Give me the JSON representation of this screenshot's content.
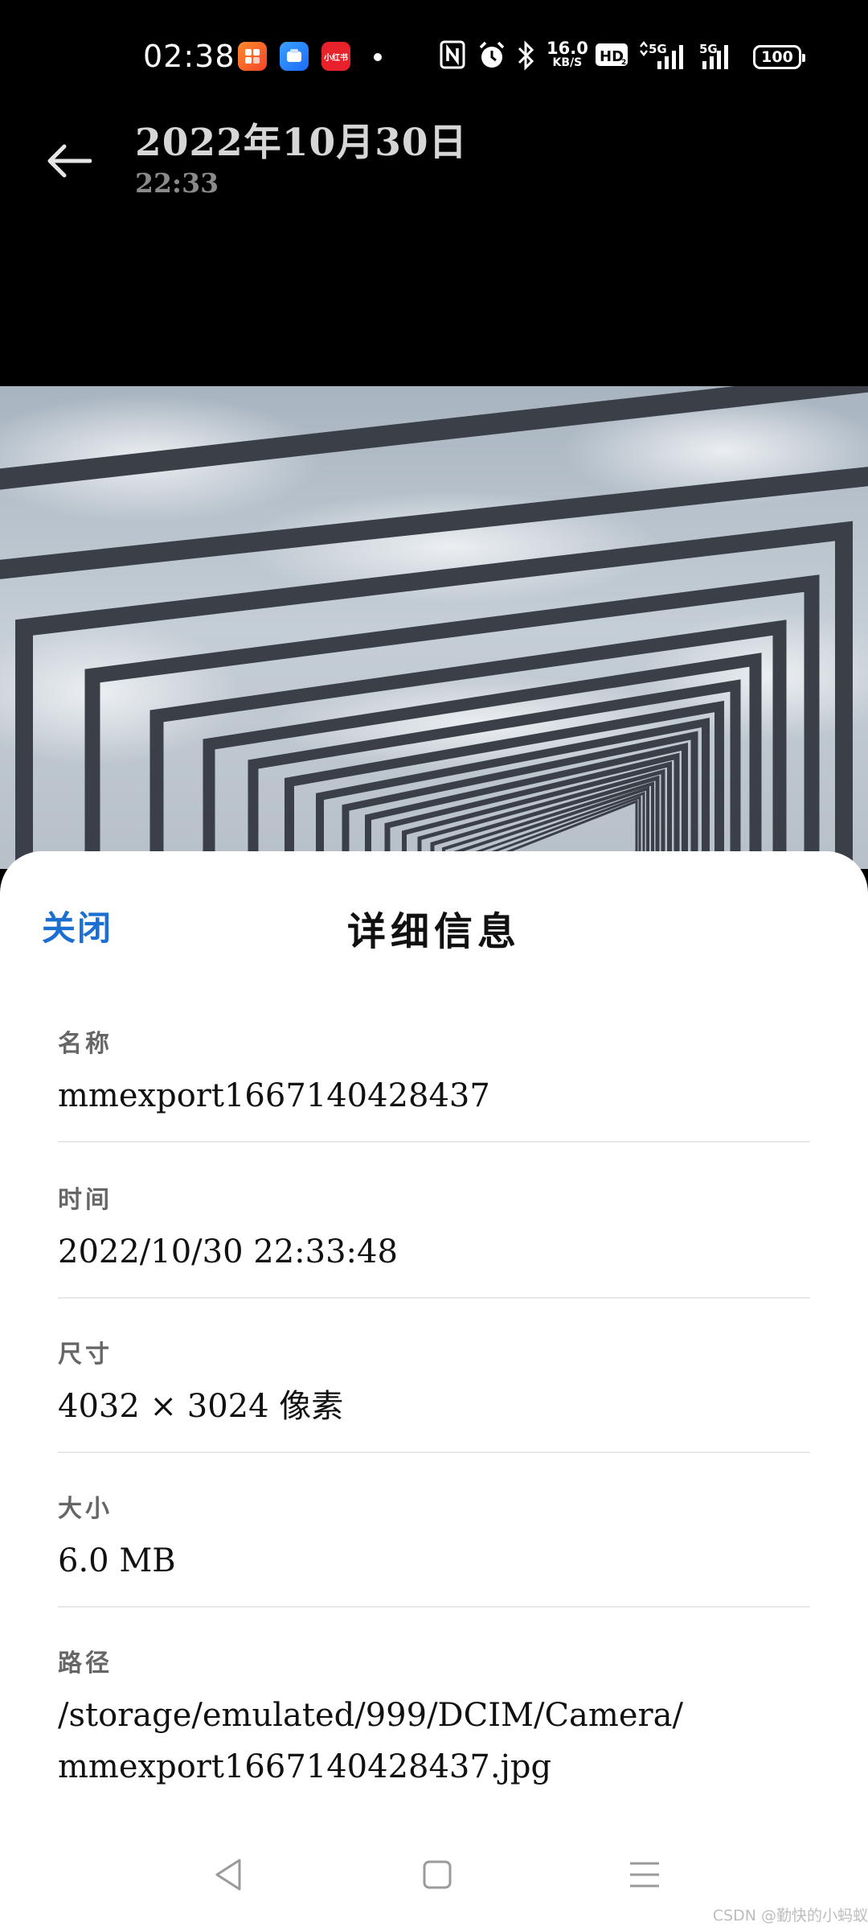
{
  "status_bar": {
    "time": "02:38",
    "apps": [
      {
        "icon": "app-orange-icon",
        "label": ""
      },
      {
        "icon": "app-blue-icon",
        "label": ""
      },
      {
        "icon": "app-red-icon",
        "label": "小红书"
      }
    ],
    "icons": [
      "nfc-icon",
      "alarm-icon",
      "bluetooth-icon",
      "hd-icon",
      "signal-5g-icon",
      "signal-5g-icon"
    ],
    "speed_value": "16.0",
    "speed_unit": "KB/S",
    "battery": "100"
  },
  "header": {
    "date": "2022年10月30日",
    "time": "22:33"
  },
  "sheet": {
    "close_label": "关闭",
    "title": "详细信息",
    "rows": [
      {
        "label": "名称",
        "value": "mmexport1667140428437"
      },
      {
        "label": "时间",
        "value": "2022/10/30 22:33:48"
      },
      {
        "label": "尺寸",
        "value": "4032 × 3024 像素"
      },
      {
        "label": "大小",
        "value": "6.0 MB"
      },
      {
        "label": "路径",
        "value_line1": "/storage/emulated/999/DCIM/Camera/",
        "value_line2": "mmexport1667140428437.jpg"
      }
    ]
  },
  "nav": [
    "back-nav-icon",
    "home-nav-icon",
    "menu-nav-icon"
  ],
  "watermark": "CSDN @勤快的小蚂蚁",
  "colors": {
    "background": "#000000",
    "sheet": "#ffffff",
    "accent": "#1a6fd1"
  }
}
